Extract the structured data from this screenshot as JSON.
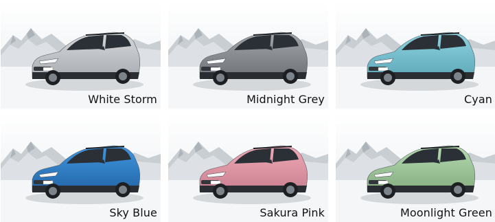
{
  "colors": [
    {
      "label": "White Storm",
      "body": "#d7d9dc",
      "shade": "#a9adb2"
    },
    {
      "label": "Midnight Grey",
      "body": "#a3a6aa",
      "shade": "#6f7378"
    },
    {
      "label": "Cyan",
      "body": "#8fd3e1",
      "shade": "#5ea9ba"
    },
    {
      "label": "Sky Blue",
      "body": "#3f97e0",
      "shade": "#2466a8"
    },
    {
      "label": "Sakura Pink",
      "body": "#f1aab8",
      "shade": "#c97f8f"
    },
    {
      "label": "Moonlight Green",
      "body": "#b6dbb1",
      "shade": "#84ad80"
    }
  ]
}
